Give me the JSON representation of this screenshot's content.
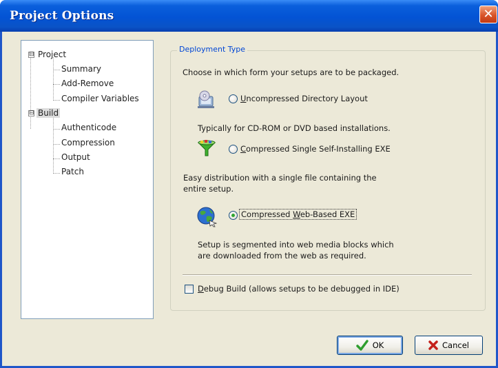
{
  "window": {
    "title": "Project Options",
    "close_icon": "close-icon"
  },
  "tree": {
    "items": [
      {
        "label": "Project",
        "expander": "⊟"
      },
      {
        "label": "Summary"
      },
      {
        "label": "Add-Remove"
      },
      {
        "label": "Compiler Variables"
      },
      {
        "label": "Build",
        "expander": "⊟",
        "selected": true
      },
      {
        "label": "Authenticode"
      },
      {
        "label": "Compression"
      },
      {
        "label": "Output"
      },
      {
        "label": "Patch"
      }
    ]
  },
  "deployment": {
    "legend": "Deployment Type",
    "intro": "Choose in which form your setups are to be packaged.",
    "options": [
      {
        "accel": "U",
        "rest": "ncompressed Directory Layout",
        "icon": "directory-install-icon",
        "checked": false,
        "desc": [
          "Typically for CD-ROM or DVD based installations."
        ]
      },
      {
        "accel": "C",
        "rest": "ompressed Single Self-Installing EXE",
        "icon": "funnel-compress-icon",
        "checked": false,
        "desc": [
          "Easy distribution with a single file containing the",
          "entire setup."
        ]
      },
      {
        "prefix": "Compressed ",
        "accel": "W",
        "rest": "eb-Based EXE",
        "icon": "globe-web-icon",
        "checked": true,
        "desc": [
          "Setup is segmented into web media blocks which",
          "are downloaded from the web as required."
        ]
      }
    ],
    "debug": {
      "accel": "D",
      "rest": "ebug Build (allows setups to be debugged in IDE)",
      "checked": false
    }
  },
  "buttons": {
    "ok": {
      "label": "OK",
      "icon": "checkmark-icon",
      "color": "#2f9e2f"
    },
    "cancel": {
      "label": "Cancel",
      "icon": "x-icon",
      "color": "#c4211b"
    }
  }
}
